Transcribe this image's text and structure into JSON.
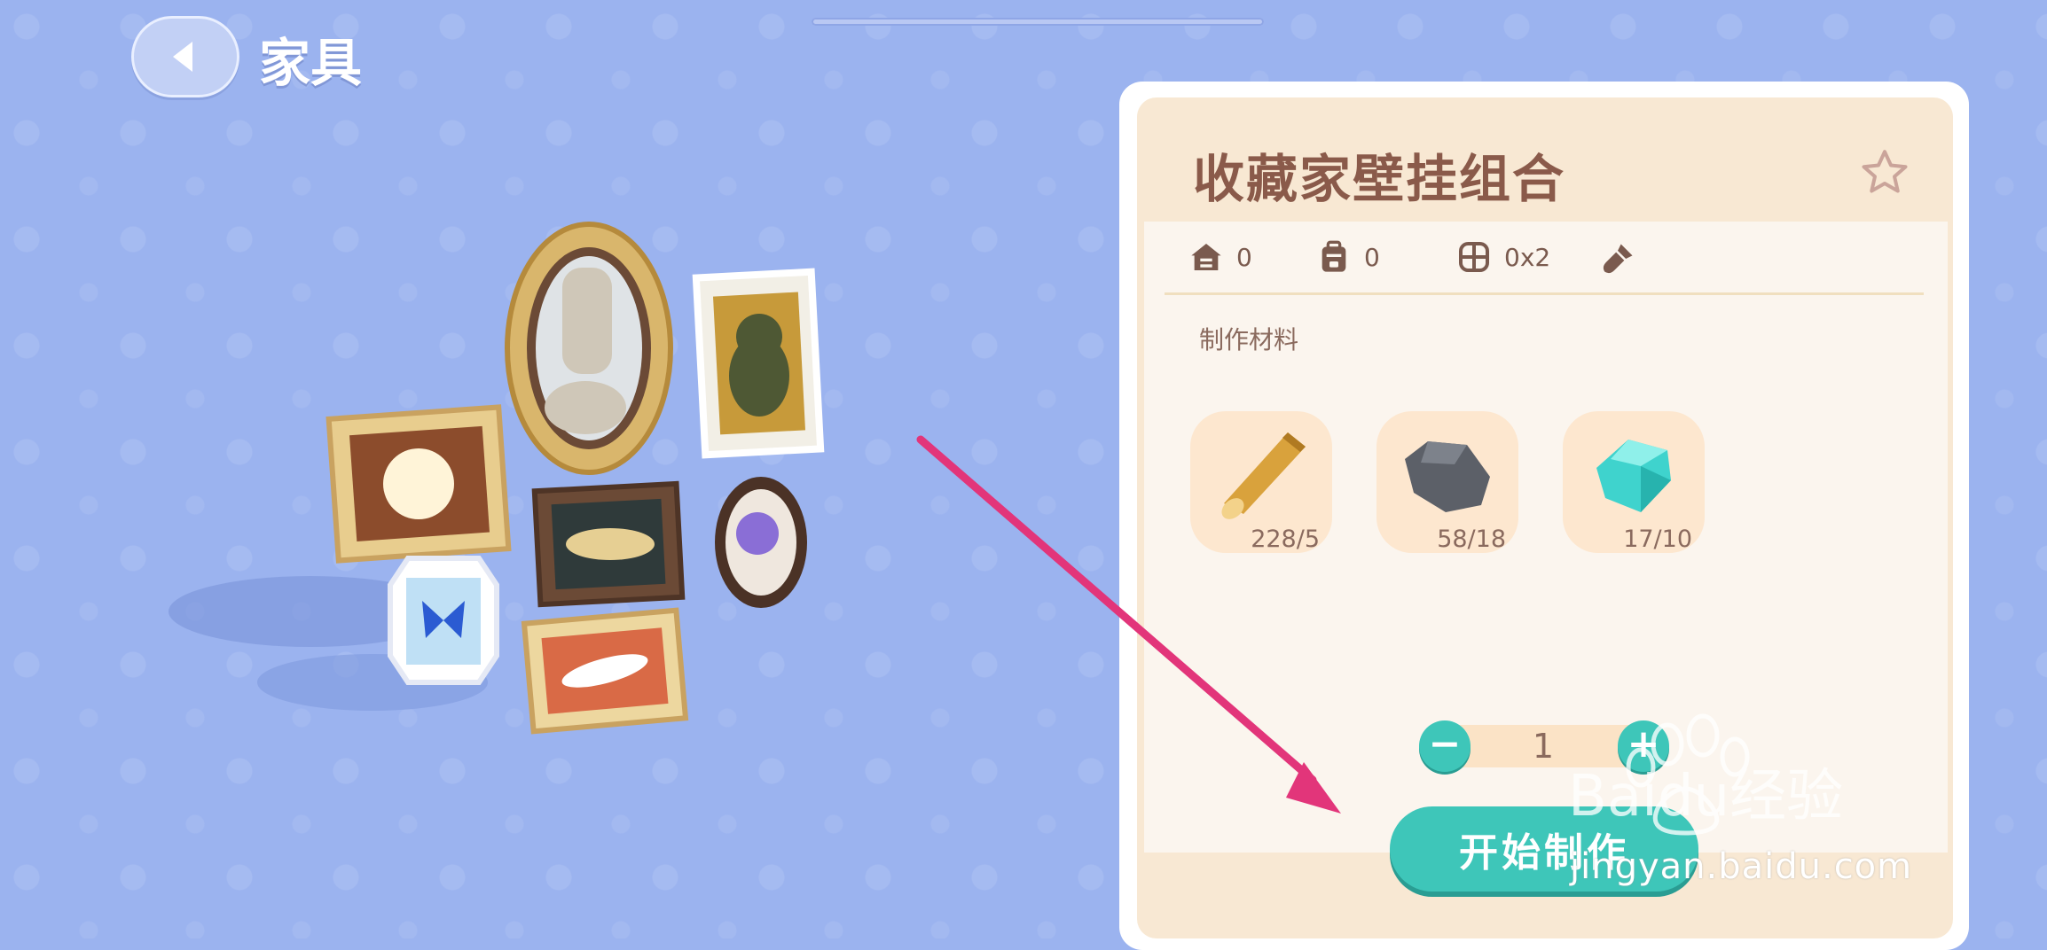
{
  "header": {
    "back_icon": "chevron-left-icon",
    "title": "家具"
  },
  "item": {
    "name": "收藏家壁挂组合",
    "favorite_icon": "star-outline-icon",
    "stats": [
      {
        "icon": "house-icon",
        "value": "0"
      },
      {
        "icon": "backpack-icon",
        "value": "0"
      },
      {
        "icon": "grid-size-icon",
        "value": "0x2"
      },
      {
        "icon": "paint-brush-icon",
        "value": ""
      }
    ]
  },
  "materials": {
    "label": "制作材料",
    "items": [
      {
        "icon": "wood-log-icon",
        "count": "228/5"
      },
      {
        "icon": "stone-icon",
        "count": "58/18"
      },
      {
        "icon": "crystal-icon",
        "count": "17/10"
      }
    ]
  },
  "quantity": {
    "value": "1",
    "minus_icon": "minus-icon",
    "plus_icon": "plus-icon"
  },
  "craft_button": "开始制作",
  "watermark": {
    "logo": "Baidu经验",
    "url": "jingyan.baidu.com"
  },
  "colors": {
    "background": "#9bb3ef",
    "panel": "#f8e8d3",
    "accent": "#3ec6b9",
    "title_text": "#8a5a4a",
    "arrow": "#e2357a"
  }
}
